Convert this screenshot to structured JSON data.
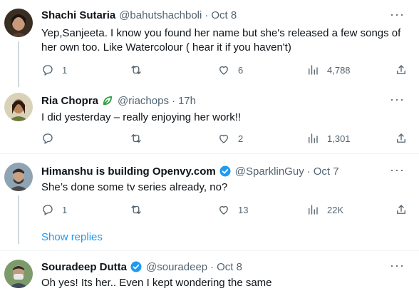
{
  "tweets": [
    {
      "name": "Shachi Sutaria",
      "handle": "@bahutshachboli",
      "time": "Oct 8",
      "badge": "",
      "text": "Yep,Sanjeeta. I know you found her name but she's released a few songs of her own too. Like Watercolour ( hear it if you haven't)",
      "replies": "1",
      "retweets": "",
      "likes": "6",
      "views": "4,788"
    },
    {
      "name": "Ria Chopra",
      "handle": "@riachops",
      "time": "17h",
      "badge": "green-leaf",
      "text": "I did yesterday – really enjoying her work!!",
      "replies": "",
      "retweets": "",
      "likes": "2",
      "views": "1,301"
    },
    {
      "name": "Himanshu is building Openvy.com",
      "handle": "@SparklinGuy",
      "time": "Oct 7",
      "badge": "verified",
      "text": "She’s done some tv series already, no?",
      "replies": "1",
      "retweets": "",
      "likes": "13",
      "views": "22K"
    },
    {
      "name": "Souradeep Dutta",
      "handle": "@souradeep",
      "time": "Oct 8",
      "badge": "verified",
      "text": "Oh yes! Its her.. Even I kept wondering the same"
    }
  ],
  "show_replies": "Show replies",
  "more": "···",
  "dot": "·",
  "colors": {
    "accent": "#1d9bf0",
    "muted": "#536471",
    "text": "#0f1419",
    "divider": "#eff3f4",
    "thread": "#cfd9de"
  },
  "icons": [
    "more-icon",
    "reply-icon",
    "retweet-icon",
    "like-icon",
    "views-icon",
    "share-icon",
    "verified-icon",
    "leaf-badge-icon"
  ]
}
